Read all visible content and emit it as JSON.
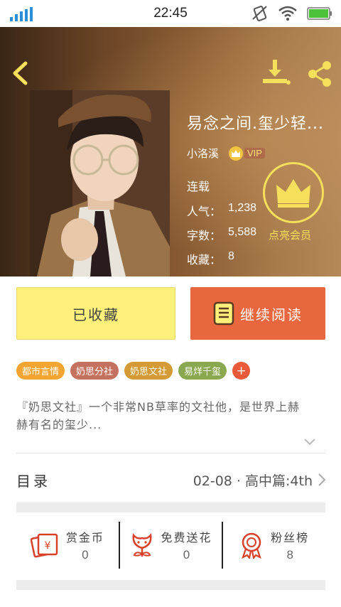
{
  "status_bar": {
    "time": "22:45"
  },
  "book": {
    "title": "易念之间.玺少轻...",
    "author": "小洛溪",
    "vip_label": "VIP",
    "status": "连载",
    "stats": [
      {
        "label": "人气：",
        "value": "1,238"
      },
      {
        "label": "字数：",
        "value": "5,588"
      },
      {
        "label": "收藏：",
        "value": "8"
      }
    ],
    "member_label": "点亮会员"
  },
  "actions": {
    "favorite_label": "已收藏",
    "read_label": "继续阅读"
  },
  "tags": [
    {
      "label": "都市言情",
      "color": "#f2a530"
    },
    {
      "label": "奶思分社",
      "color": "#c4725f"
    },
    {
      "label": "奶思文社",
      "color": "#d39a35"
    },
    {
      "label": "易烊千玺",
      "color": "#8aa84f"
    }
  ],
  "tag_add_label": "+",
  "description": "『奶思文社』一个非常NB草率的文社他，是世界上赫赫有名的玺少...",
  "toc": {
    "label": "目录",
    "latest": "02-08 · 高中篇:4th"
  },
  "gifts": [
    {
      "label": "赏金币",
      "count": "0",
      "icon": "red-envelope-icon"
    },
    {
      "label": "免费送花",
      "count": "0",
      "icon": "flower-icon"
    },
    {
      "label": "粉丝榜",
      "count": "8",
      "icon": "medal-icon"
    }
  ],
  "colors": {
    "accent": "#e9673f",
    "favorite_bg": "#fcef7a",
    "crown": "#f6df5a"
  }
}
